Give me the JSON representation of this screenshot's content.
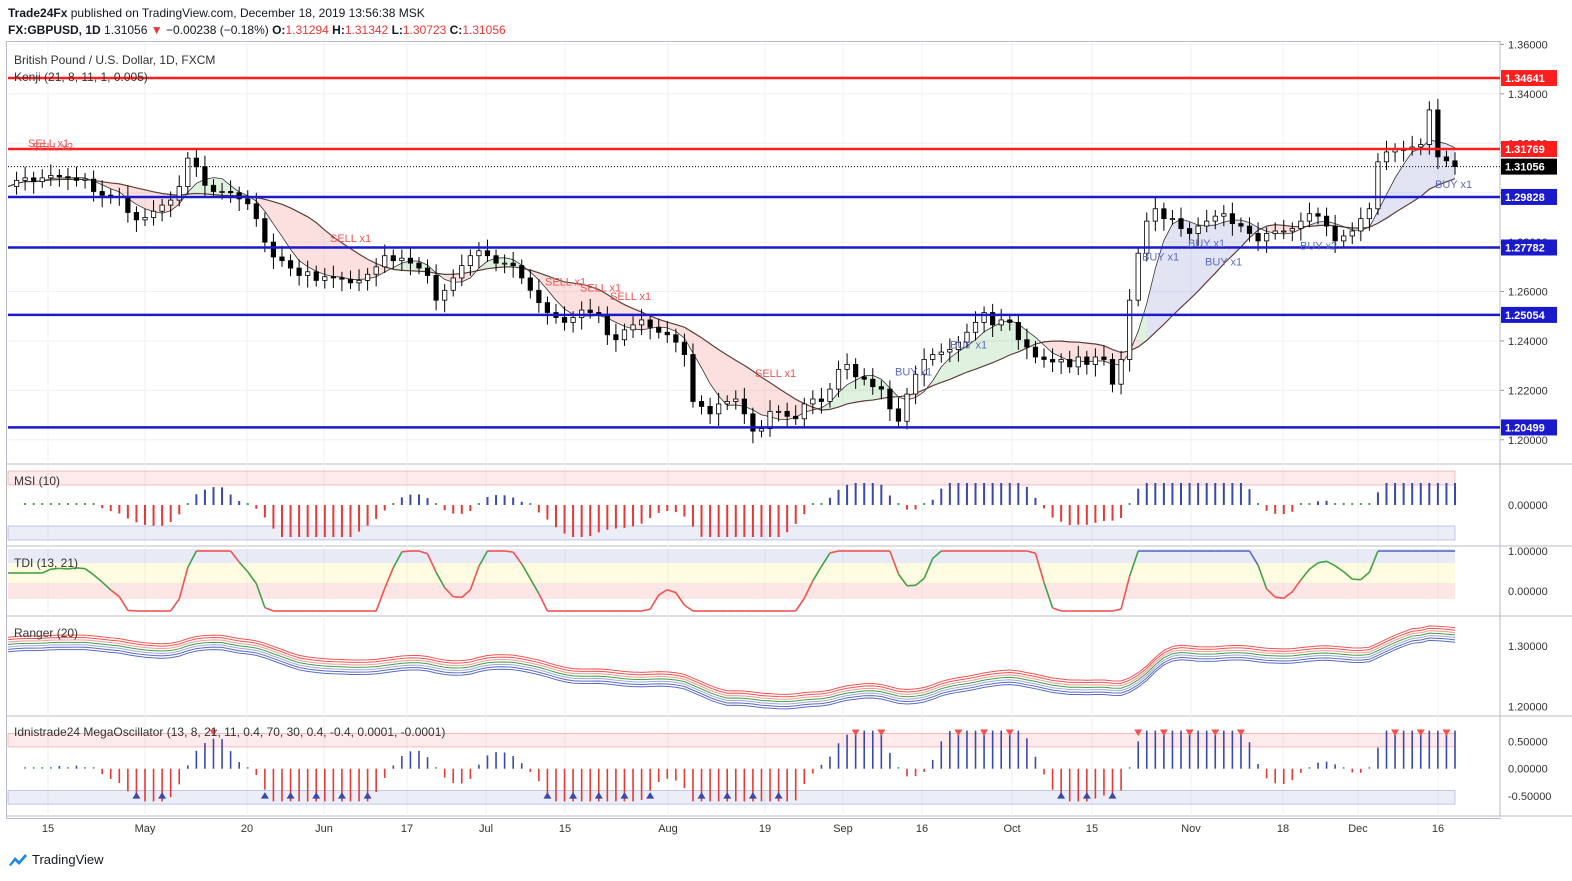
{
  "header": {
    "publisher": "Trade24Fx",
    "published_text": "published on TradingView.com, December 18, 2019 13:56:38 MSK",
    "symbol": "FX:GBPUSD, 1D",
    "last": "1.31056",
    "change": "−0.00238 (−0.18%)",
    "o_label": "O:",
    "o": "1.31294",
    "h_label": "H:",
    "h": "1.31342",
    "l_label": "L:",
    "l": "1.30723",
    "c_label": "C:",
    "c": "1.31056"
  },
  "panes": {
    "main_title": "British Pound / U.S. Dollar, 1D, FXCM",
    "main_indicator": "Kenji (21, 8, 11, 1, 0.005)",
    "msi": "MSI (10)",
    "tdi": "TDI (13, 21)",
    "ranger": "Ranger (20)",
    "mega": "Idnistrade24 MegaOscillator (13, 8, 21, 11, 0.4, 70, 30, 0.4, -0.4, 0.0001, -0.0001)"
  },
  "footer": {
    "logo": "TradingView"
  },
  "colors": {
    "red_level": "#ff1e1e",
    "blue_level": "#1a1acc",
    "up": "#ffffff",
    "down": "#000000",
    "sell": "#ef5350",
    "buy": "#5c6bc0"
  },
  "chart_data": [
    {
      "type": "candlestick",
      "title": "British Pound / U.S. Dollar, 1D, FXCM",
      "x_ticks": [
        "15",
        "May",
        "20",
        "Jun",
        "17",
        "Jul",
        "15",
        "Aug",
        "19",
        "Sep",
        "16",
        "Oct",
        "15",
        "Nov",
        "18",
        "Dec",
        "16"
      ],
      "y_ticks": [
        "1.36000",
        "1.34000",
        "1.32000",
        "1.30000",
        "1.28000",
        "1.26000",
        "1.24000",
        "1.22000",
        "1.20000"
      ],
      "ylim": [
        1.191,
        1.361
      ],
      "last_price": 1.31056,
      "levels": [
        {
          "value": 1.34641,
          "label": "1.34641",
          "color": "red"
        },
        {
          "value": 1.31769,
          "label": "1.31769",
          "color": "red"
        },
        {
          "value": 1.29828,
          "label": "1.29828",
          "color": "blue"
        },
        {
          "value": 1.27782,
          "label": "1.27782",
          "color": "blue"
        },
        {
          "value": 1.25054,
          "label": "1.25054",
          "color": "blue"
        },
        {
          "value": 1.20499,
          "label": "1.20499",
          "color": "blue"
        }
      ],
      "close_path": [
        1.3025,
        1.305,
        1.306,
        1.3045,
        1.306,
        1.307,
        1.3065,
        1.306,
        1.305,
        1.3055,
        1.3005,
        1.299,
        1.298,
        1.2985,
        1.292,
        1.289,
        1.29,
        1.2925,
        1.295,
        1.297,
        1.3025,
        1.314,
        1.3105,
        1.303,
        1.3005,
        1.3005,
        1.3,
        1.2975,
        1.2955,
        1.2895,
        1.28,
        1.274,
        1.2725,
        1.2695,
        1.2665,
        1.268,
        1.2645,
        1.266,
        1.2655,
        1.265,
        1.2635,
        1.2645,
        1.267,
        1.27,
        1.2745,
        1.2725,
        1.2735,
        1.2715,
        1.2695,
        1.2665,
        1.2565,
        1.2605,
        1.2655,
        1.2705,
        1.2745,
        1.2765,
        1.2745,
        1.2715,
        1.2715,
        1.2705,
        1.2655,
        1.2605,
        1.2555,
        1.2515,
        1.2495,
        1.2475,
        1.2495,
        1.2525,
        1.2515,
        1.2505,
        1.2425,
        1.2405,
        1.2445,
        1.2465,
        1.2485,
        1.2455,
        1.2435,
        1.2425,
        1.2395,
        1.2345,
        1.2155,
        1.2135,
        1.2105,
        1.2145,
        1.2155,
        1.2165,
        1.2105,
        1.2035,
        1.2045,
        1.2115,
        1.2115,
        1.2095,
        1.2085,
        1.2145,
        1.2165,
        1.2155,
        1.2205,
        1.2285,
        1.2305,
        1.2255,
        1.2245,
        1.2215,
        1.2205,
        1.2125,
        1.2075,
        1.2185,
        1.2265,
        1.2325,
        1.2345,
        1.2355,
        1.2365,
        1.2395,
        1.2435,
        1.2475,
        1.2515,
        1.2465,
        1.2485,
        1.2475,
        1.2405,
        1.2375,
        1.2335,
        1.2325,
        1.2315,
        1.2325,
        1.2295,
        1.2335,
        1.2305,
        1.2335,
        1.2325,
        1.2225,
        1.2325,
        1.2565,
        1.2755,
        1.2885,
        1.2935,
        1.2895,
        1.2895,
        1.2855,
        1.2835,
        1.2865,
        1.2885,
        1.2905,
        1.2915,
        1.2875,
        1.2865,
        1.2835,
        1.2805,
        1.2835,
        1.2845,
        1.2845,
        1.2855,
        1.2885,
        1.2915,
        1.2905,
        1.2865,
        1.2805,
        1.2825,
        1.2845,
        1.2895,
        1.2935,
        1.3125,
        1.3165,
        1.3175,
        1.3175,
        1.3185,
        1.3195,
        1.3335,
        1.3145,
        1.3129,
        1.31056
      ],
      "labels": [
        {
          "text": "SELL x1",
          "x": 28,
          "y": 1.3185,
          "side": "sell"
        },
        {
          "text": "SELL x2",
          "x": 32,
          "y": 1.317,
          "side": "sell"
        },
        {
          "text": "SELL x1",
          "x": 330,
          "y": 1.28,
          "side": "sell"
        },
        {
          "text": "SELL x1",
          "x": 545,
          "y": 1.2625,
          "side": "sell"
        },
        {
          "text": "SELL x1",
          "x": 580,
          "y": 1.26,
          "side": "sell"
        },
        {
          "text": "SELL x1",
          "x": 610,
          "y": 1.2565,
          "side": "sell"
        },
        {
          "text": "SELL x1",
          "x": 755,
          "y": 1.2255,
          "side": "sell"
        },
        {
          "text": "BUY x1",
          "x": 895,
          "y": 1.226,
          "side": "buy"
        },
        {
          "text": "BUY x1",
          "x": 950,
          "y": 1.237,
          "side": "buy"
        },
        {
          "text": "BUY x1",
          "x": 1142,
          "y": 1.2725,
          "side": "buy"
        },
        {
          "text": "BUY x1",
          "x": 1188,
          "y": 1.278,
          "side": "buy"
        },
        {
          "text": "BUY x1",
          "x": 1205,
          "y": 1.2705,
          "side": "buy"
        },
        {
          "text": "BUY x2",
          "x": 1300,
          "y": 1.277,
          "side": "buy"
        },
        {
          "text": "BUY x1",
          "x": 1435,
          "y": 1.302,
          "side": "buy"
        }
      ]
    },
    {
      "type": "bar",
      "title": "MSI (10)",
      "y_ticks": [
        "0.00000"
      ],
      "note": "histogram of momentum strength; red below zero, blue above, green near zero"
    },
    {
      "type": "line",
      "title": "TDI (13, 21)",
      "y_ticks": [
        "1.00000",
        "0.00000"
      ],
      "ylim": [
        -0.6,
        1.1
      ]
    },
    {
      "type": "line",
      "title": "Ranger (20)",
      "y_ticks": [
        "1.30000",
        "1.20000"
      ],
      "ylim": [
        1.186,
        1.348
      ]
    },
    {
      "type": "bar",
      "title": "Idnistrade24 MegaOscillator (13, 8, 21, 11, 0.4, 70, 30, 0.4, -0.4, 0.0001, -0.0001)",
      "y_ticks": [
        "0.50000",
        "0.00000",
        "-0.50000"
      ],
      "ylim": [
        -0.85,
        0.95
      ]
    }
  ]
}
